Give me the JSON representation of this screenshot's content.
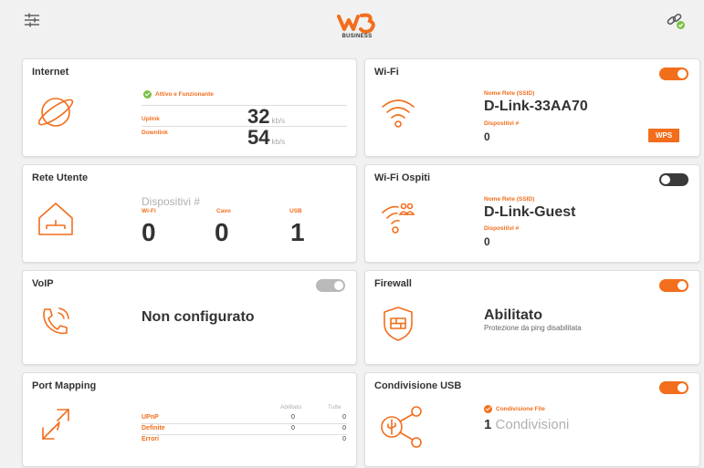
{
  "header": {
    "settings_icon": "sliders-icon",
    "logo_text": "BUSINESS",
    "link_icon": "link-status-icon"
  },
  "colors": {
    "accent": "#f26e1c",
    "ok": "#7bc143",
    "toggle_off": "#3a3a3a",
    "toggle_disabled": "#b9b9b9"
  },
  "internet": {
    "title": "Internet",
    "status": "Attivo e Funzionante",
    "uplink_label": "Uplink",
    "uplink_value": "32",
    "uplink_unit": "kb/s",
    "downlink_label": "Downlink",
    "downlink_value": "54",
    "downlink_unit": "kb/s"
  },
  "wifi": {
    "title": "Wi-Fi",
    "toggle": "on",
    "ssid_label": "Nome Rete (SSID)",
    "ssid": "D-Link-33AA70",
    "devices_label": "Dispositivi #",
    "devices": "0",
    "wps": "WPS"
  },
  "rete_utente": {
    "title": "Rete Utente",
    "devices_label": "Dispositivi #",
    "cols": [
      {
        "label": "Wi-Fi",
        "value": "0"
      },
      {
        "label": "Cavo",
        "value": "0"
      },
      {
        "label": "USB",
        "value": "1"
      }
    ]
  },
  "wifi_ospiti": {
    "title": "Wi-Fi Ospiti",
    "toggle": "off",
    "ssid_label": "Nome Rete (SSID)",
    "ssid": "D-Link-Guest",
    "devices_label": "Dispositivi #",
    "devices": "0"
  },
  "voip": {
    "title": "VoIP",
    "toggle": "disabled",
    "status": "Non configurato"
  },
  "firewall": {
    "title": "Firewall",
    "toggle": "on",
    "status": "Abilitato",
    "detail": "Protezione da ping disabilitata"
  },
  "port_mapping": {
    "title": "Port Mapping",
    "col_enabled": "Abilitato",
    "col_all": "Tutte",
    "rows": [
      {
        "label": "UPnP",
        "enabled": "0",
        "all": "0"
      },
      {
        "label": "Definite",
        "enabled": "0",
        "all": "0"
      },
      {
        "label": "Errori",
        "enabled": "",
        "all": "0"
      }
    ]
  },
  "usb": {
    "title": "Condivisione USB",
    "toggle": "on",
    "status": "Condivisione File",
    "count": "1",
    "count_label": "Condivisioni"
  }
}
